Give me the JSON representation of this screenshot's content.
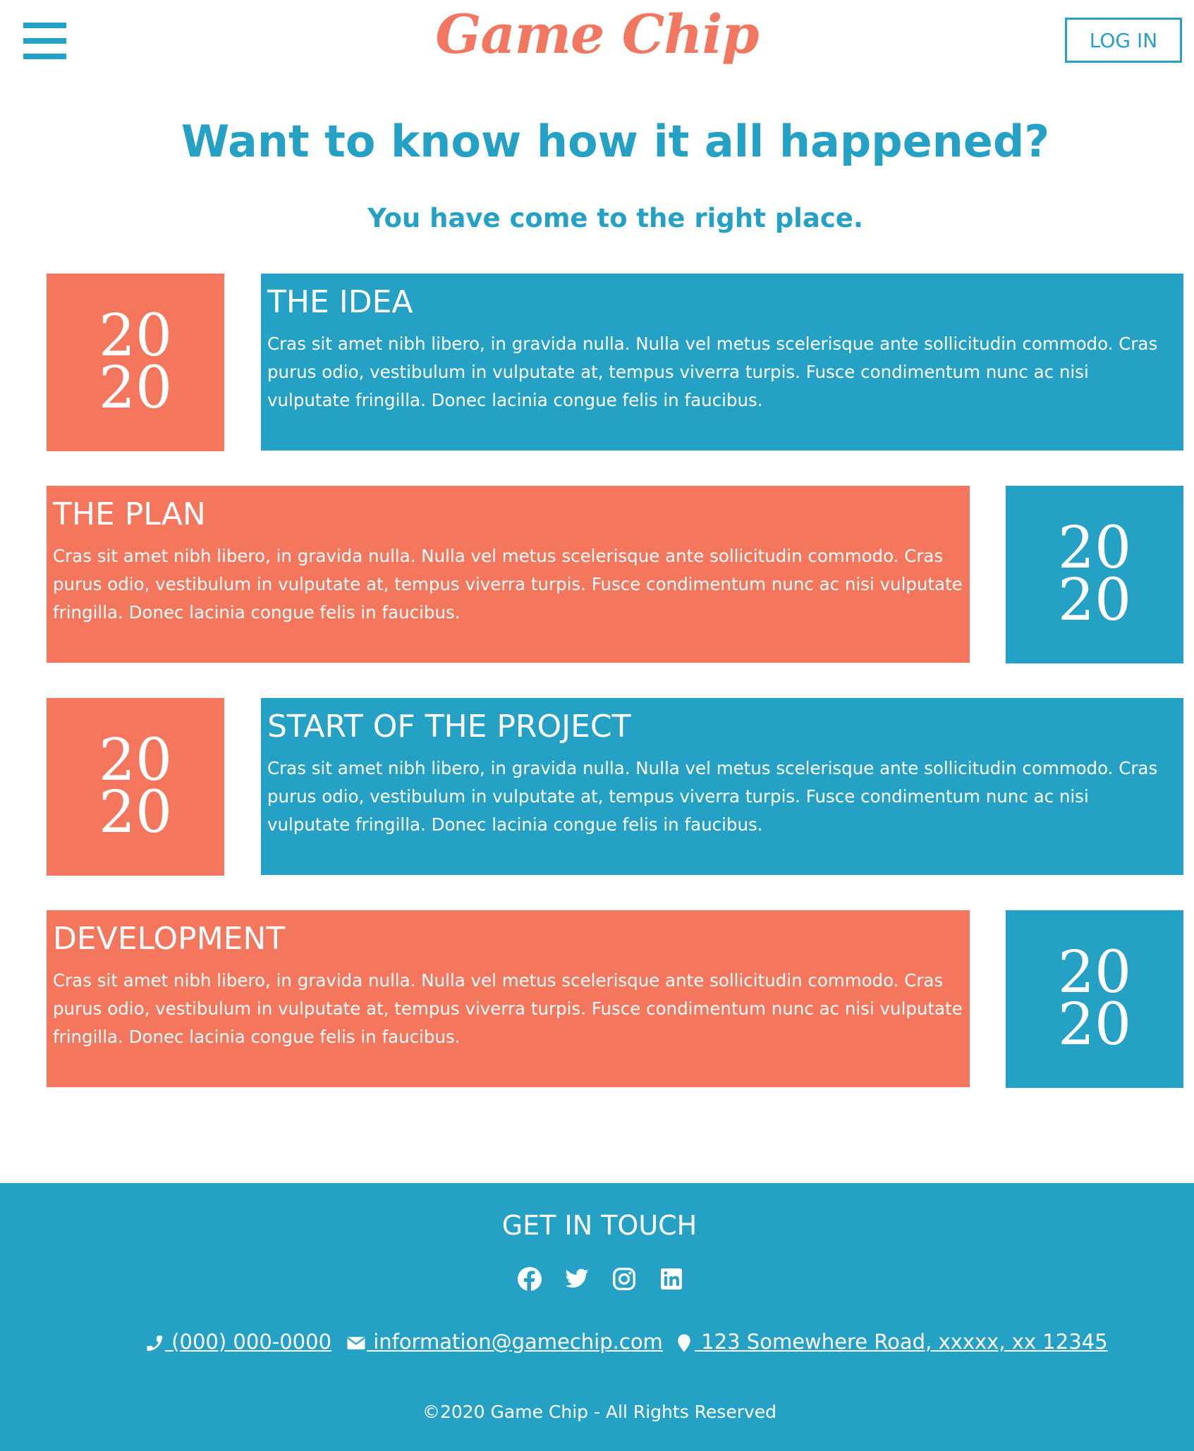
{
  "header": {
    "menu_icon": "hamburger-menu-icon",
    "logo_text": "Game Chip",
    "login_label": "LOG IN"
  },
  "hero": {
    "title": "Want to know how it all happened?",
    "subtitle": "You have come to the right place."
  },
  "timeline": [
    {
      "year_top": "20",
      "year_bottom": "20",
      "heading": "THE IDEA",
      "body": "Cras sit amet nibh libero, in gravida nulla. Nulla vel metus scelerisque ante sollicitudin commodo. Cras purus odio, vestibulum in vulputate at, tempus viverra turpis. Fusce condimentum nunc ac nisi vulputate fringilla. Donec lacinia congue felis in faucibus."
    },
    {
      "year_top": "20",
      "year_bottom": "20",
      "heading": "THE PLAN",
      "body": "Cras sit amet nibh libero, in gravida nulla. Nulla vel metus scelerisque ante sollicitudin commodo. Cras purus odio, vestibulum in vulputate at, tempus viverra turpis. Fusce condimentum nunc ac nisi vulputate fringilla. Donec lacinia congue felis in faucibus."
    },
    {
      "year_top": "20",
      "year_bottom": "20",
      "heading": "START OF THE PROJECT",
      "body": "Cras sit amet nibh libero, in gravida nulla. Nulla vel metus scelerisque ante sollicitudin commodo. Cras purus odio, vestibulum in vulputate at, tempus viverra turpis. Fusce condimentum nunc ac nisi vulputate fringilla. Donec lacinia congue felis in faucibus."
    },
    {
      "year_top": "20",
      "year_bottom": "20",
      "heading": "DEVELOPMENT",
      "body": "Cras sit amet nibh libero, in gravida nulla. Nulla vel metus scelerisque ante sollicitudin commodo. Cras purus odio, vestibulum in vulputate at, tempus viverra turpis. Fusce condimentum nunc ac nisi vulputate fringilla. Donec lacinia congue felis in faucibus."
    }
  ],
  "footer": {
    "title": "GET IN TOUCH",
    "social_icons": [
      "facebook-icon",
      "twitter-icon",
      "instagram-icon",
      "linkedin-icon"
    ],
    "phone": " (000) 000-0000",
    "email": " information@gamechip.com",
    "address": " 123 Somewhere Road, xxxxx, xx 12345",
    "copyright": "©2020 Game Chip - All Rights Reserved"
  },
  "colors": {
    "accent_blue": "#25a1c6",
    "accent_coral": "#f4765d",
    "logo_coral": "#f27760",
    "background": "#ffffff"
  }
}
